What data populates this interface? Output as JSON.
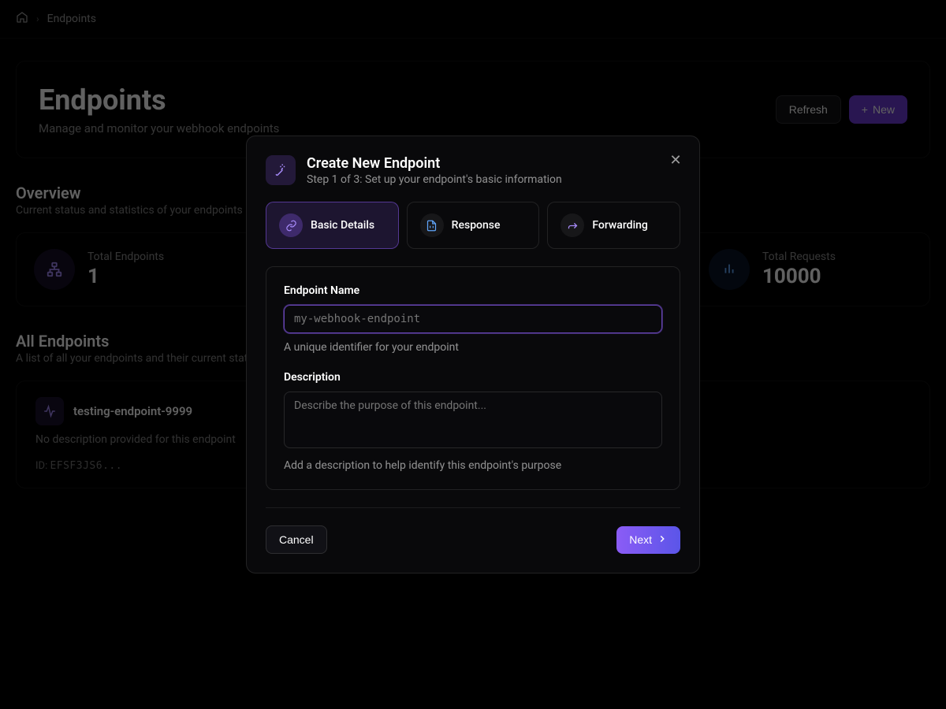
{
  "breadcrumb": {
    "current": "Endpoints"
  },
  "header": {
    "title": "Endpoints",
    "subtitle": "Manage and monitor your webhook endpoints",
    "refresh_label": "Refresh",
    "new_label": "New"
  },
  "overview": {
    "title": "Overview",
    "subtitle": "Current status and statistics of your endpoints",
    "stats": [
      {
        "label": "Total Endpoints",
        "value": "1"
      },
      {
        "label": "Total Requests",
        "value": "10000"
      }
    ]
  },
  "list": {
    "title": "All Endpoints",
    "subtitle": "A list of all your endpoints and their current status",
    "items": [
      {
        "name": "testing-endpoint-9999",
        "description": "No description provided for this endpoint",
        "id_prefix": "ID: ",
        "id_value": "EFSF3JS6..."
      }
    ]
  },
  "modal": {
    "title": "Create New Endpoint",
    "subtitle": "Step 1 of 3: Set up your endpoint's basic information",
    "steps": [
      {
        "label": "Basic Details"
      },
      {
        "label": "Response"
      },
      {
        "label": "Forwarding"
      }
    ],
    "form": {
      "name_label": "Endpoint Name",
      "name_placeholder": "my-webhook-endpoint",
      "name_hint": "A unique identifier for your endpoint",
      "desc_label": "Description",
      "desc_placeholder": "Describe the purpose of this endpoint...",
      "desc_hint": "Add a description to help identify this endpoint's purpose"
    },
    "cancel_label": "Cancel",
    "next_label": "Next"
  }
}
